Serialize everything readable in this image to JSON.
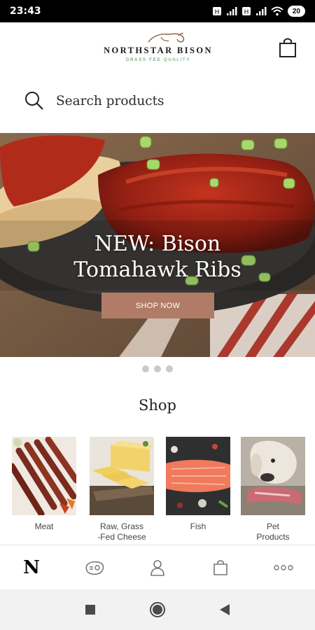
{
  "status_bar": {
    "time": "23:43",
    "battery": "20"
  },
  "header": {
    "brand": "NORTHSTAR BISON",
    "tagline": "GRASS FED QUALITY",
    "cart_icon": "shopping-bag-icon"
  },
  "search": {
    "placeholder": "Search products",
    "icon": "search-icon"
  },
  "banner": {
    "title_line1": "NEW: Bison",
    "title_line2": "Tomahawk Ribs",
    "button_label": "SHOP NOW",
    "slide_count": 3,
    "accent": "#b07c67"
  },
  "shop": {
    "title": "Shop",
    "categories": [
      {
        "label_line1": "Meat",
        "label_line2": ""
      },
      {
        "label_line1": "Raw, Grass",
        "label_line2": "-Fed Cheese"
      },
      {
        "label_line1": "Fish",
        "label_line2": ""
      },
      {
        "label_line1": "Pet",
        "label_line2": "Products"
      }
    ]
  },
  "bottom_nav": {
    "home_label": "N",
    "items": [
      "home-logo",
      "steak-icon",
      "account-icon",
      "shopping-bag-icon",
      "more-icon"
    ]
  },
  "system_nav": [
    "recents-icon",
    "home-icon",
    "back-icon"
  ]
}
